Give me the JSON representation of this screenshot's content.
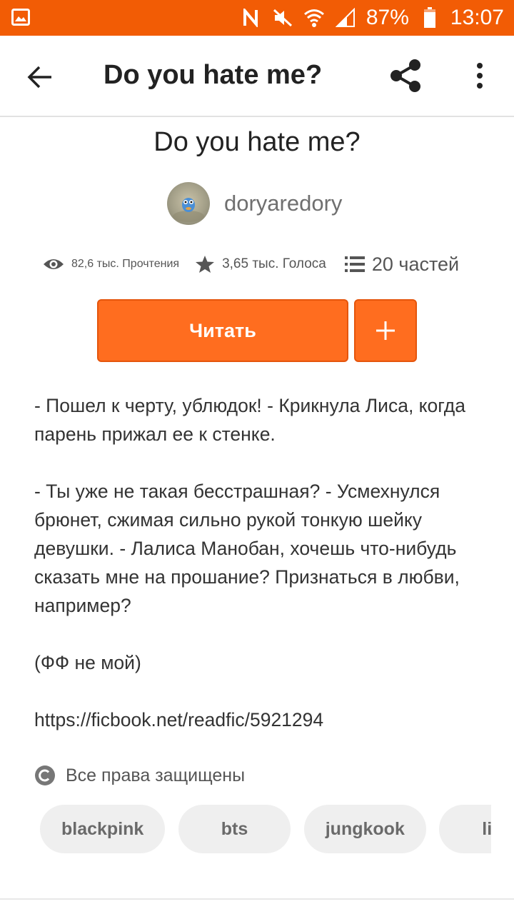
{
  "status_bar": {
    "battery_percent": "87%",
    "time": "13:07",
    "color": "#f25c05"
  },
  "toolbar": {
    "title": "Do you hate me?"
  },
  "story": {
    "title": "Do you hate me?",
    "author": "doryaredory",
    "stats": {
      "reads": "82,6 тыс. Прочтения",
      "votes": "3,65 тыс. Голоса",
      "parts": "20 частей"
    },
    "read_button": "Читать",
    "add_button": "+",
    "description": [
      "- Пошел к черту, ублюдок! - Крикнула Лиса, когда парень прижал ее к стенке.",
      "- Ты уже не такая бесстрашная? - Усмехнулся брюнет, сжимая сильно рукой тонкую шейку девушки. - Лалиса Манобан, хочешь что-нибудь сказать мне на прошание? Признаться в любви, например?",
      "(ФФ не мой)",
      "https://ficbook.net/readfic/5921294"
    ],
    "copyright": "Все права защищены",
    "tags": [
      "blackpink",
      "bts",
      "jungkook",
      "lisa"
    ]
  },
  "colors": {
    "accent": "#ff6d1f",
    "accent_border": "#e5550c"
  }
}
